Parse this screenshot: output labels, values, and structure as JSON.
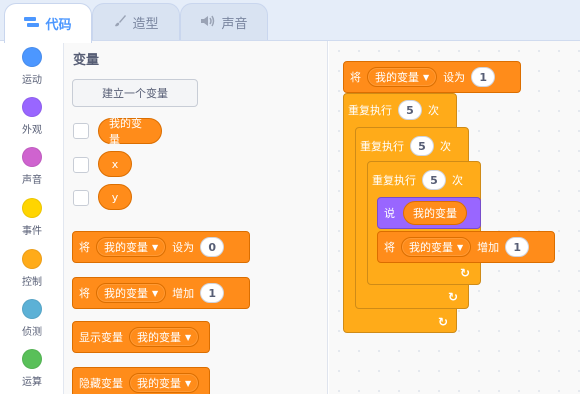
{
  "tabs": [
    {
      "label": "代码",
      "icon": "code-icon"
    },
    {
      "label": "造型",
      "icon": "brush-icon"
    },
    {
      "label": "声音",
      "icon": "speaker-icon"
    }
  ],
  "categories": [
    {
      "label": "运动",
      "color": "#4c97ff"
    },
    {
      "label": "外观",
      "color": "#9966ff"
    },
    {
      "label": "声音",
      "color": "#cf63cf"
    },
    {
      "label": "事件",
      "color": "#ffd500"
    },
    {
      "label": "控制",
      "color": "#ffab19"
    },
    {
      "label": "侦测",
      "color": "#5cb1d6"
    },
    {
      "label": "运算",
      "color": "#59c059"
    }
  ],
  "palette": {
    "title": "变量",
    "make_variable": "建立一个变量",
    "reporters": [
      "我的变量",
      "x",
      "y"
    ],
    "set_block": {
      "label": "将",
      "var": "我的变量",
      "op": "设为",
      "value": "0"
    },
    "change_block": {
      "label": "将",
      "var": "我的变量",
      "op": "增加",
      "value": "1"
    },
    "show_block": {
      "label": "显示变量",
      "var": "我的变量"
    },
    "hide_block": {
      "label": "隐藏变量",
      "var": "我的变量"
    }
  },
  "script": {
    "set": {
      "label": "将",
      "var": "我的变量",
      "op": "设为",
      "value": "1"
    },
    "repeat_label": "重复执行",
    "repeat_unit": "次",
    "repeat_outer": "5",
    "repeat_mid": "5",
    "repeat_inner": "5",
    "say": {
      "label": "说",
      "value": "我的变量"
    },
    "change": {
      "label": "将",
      "var": "我的变量",
      "op": "增加",
      "value": "1"
    }
  },
  "colors": {
    "accent": "#4c97ff",
    "variables": "#ff8c1a",
    "control": "#ffab19",
    "looks": "#9966ff"
  }
}
